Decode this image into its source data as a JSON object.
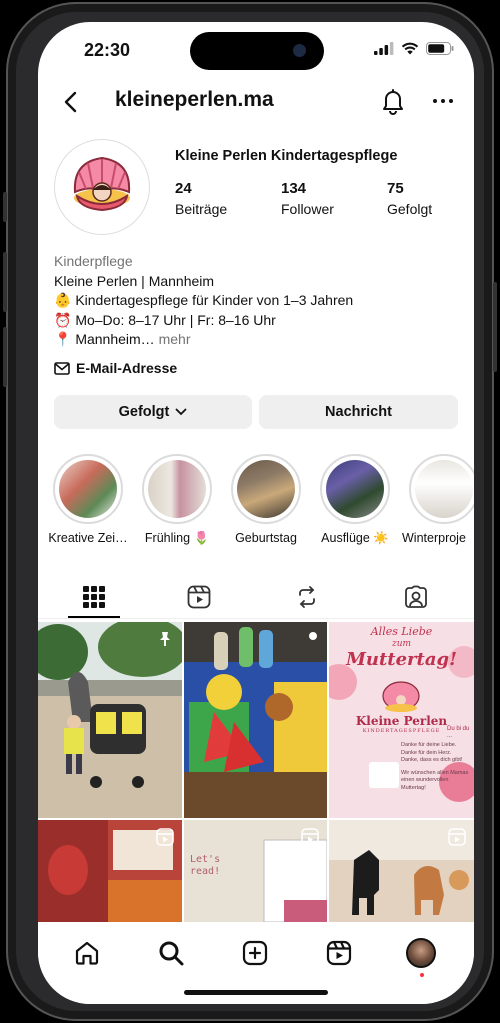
{
  "status": {
    "time": "22:30"
  },
  "header": {
    "username": "kleineperlen.ma"
  },
  "profile": {
    "name": "Kleine Perlen Kindertagespflege",
    "stats": [
      {
        "value": "24",
        "label": "Beiträge"
      },
      {
        "value": "134",
        "label": "Follower"
      },
      {
        "value": "75",
        "label": "Gefolgt"
      }
    ],
    "category": "Kinderpflege",
    "bio_lines": [
      "Kleine Perlen | Mannheim",
      "👶 Kindertagespflege für Kinder von 1–3 Jahren",
      "⏰ Mo–Do: 8–17 Uhr | Fr: 8–16 Uhr",
      "📍 Mannheim…"
    ],
    "bio_more": "mehr",
    "email_label": "E-Mail-Adresse"
  },
  "actions": {
    "follow_label": "Gefolgt",
    "message_label": "Nachricht"
  },
  "highlights": [
    {
      "label": "Kreative Zei…"
    },
    {
      "label": "Frühling 🌷"
    },
    {
      "label": "Geburtstag"
    },
    {
      "label": "Ausflüge ☀️"
    },
    {
      "label": "Winterproje"
    }
  ],
  "grid": {
    "post3": {
      "line1": "Alles Liebe",
      "line2": "zum",
      "line3": "Muttertag!",
      "brand": "Kleine Perlen",
      "brand_sub": "KINDERTAGESPFLEGE",
      "thanks1": "Danke für deine Liebe.",
      "thanks2": "Danke für dein Herz.",
      "thanks3": "Danke, dass es dich gibt!",
      "wish1": "Wir wünschen allen Mamas",
      "wish2": "einen wundervollen",
      "wish3": "Muttertag!",
      "side": "Du bi du ..."
    },
    "post5_text": "Let's read!"
  }
}
